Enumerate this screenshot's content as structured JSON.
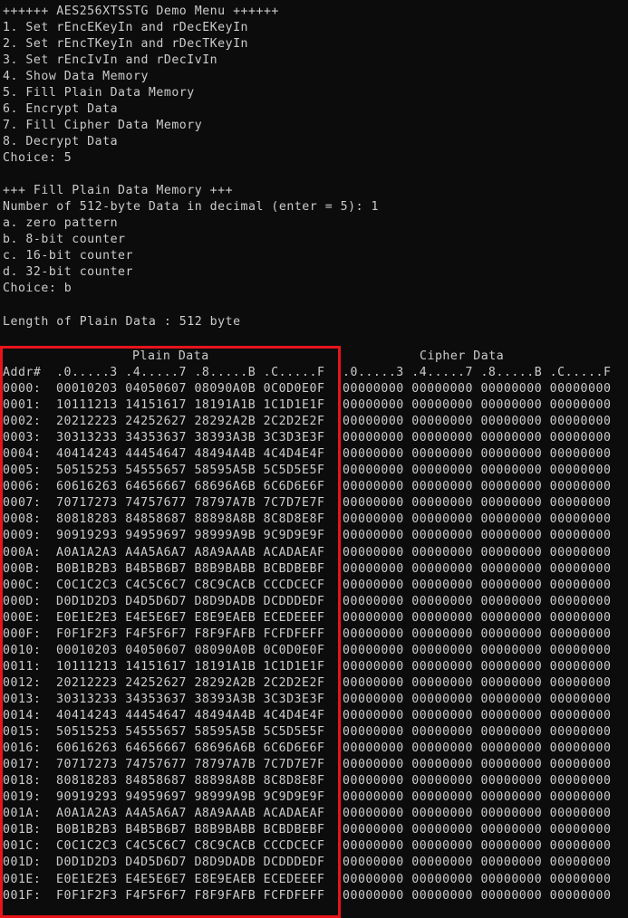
{
  "menu": {
    "title": "++++++ AES256XTSSTG Demo Menu ++++++",
    "items": [
      "1. Set rEncEKeyIn and rDecEKeyIn",
      "2. Set rEncTKeyIn and rDecTKeyIn",
      "3. Set rEncIvIn and rDecIvIn",
      "4. Show Data Memory",
      "5. Fill Plain Data Memory",
      "6. Encrypt Data",
      "7. Fill Cipher Data Memory",
      "8. Decrypt Data"
    ],
    "choice": "Choice: 5"
  },
  "fill": {
    "title": "+++ Fill Plain Data Memory +++",
    "prompt": "Number of 512-byte Data in decimal (enter = 5): 1",
    "options": [
      "a. zero pattern",
      "b. 8-bit counter",
      "c. 16-bit counter",
      "d. 32-bit counter"
    ],
    "choice": "Choice: b"
  },
  "length_line": "Length of Plain Data : 512 byte",
  "table": {
    "plain_title": "Plain Data",
    "cipher_title": "Cipher Data",
    "addr_header": "Addr#",
    "plain_cols_header": ".0.....3 .4.....7 .8.....B .C.....F",
    "cipher_cols_header": ".0.....3 .4.....7 .8.....B .C.....F",
    "rows": [
      {
        "addr": "0000:",
        "plain": "00010203 04050607 08090A0B 0C0D0E0F",
        "cipher": "00000000 00000000 00000000 00000000"
      },
      {
        "addr": "0001:",
        "plain": "10111213 14151617 18191A1B 1C1D1E1F",
        "cipher": "00000000 00000000 00000000 00000000"
      },
      {
        "addr": "0002:",
        "plain": "20212223 24252627 28292A2B 2C2D2E2F",
        "cipher": "00000000 00000000 00000000 00000000"
      },
      {
        "addr": "0003:",
        "plain": "30313233 34353637 38393A3B 3C3D3E3F",
        "cipher": "00000000 00000000 00000000 00000000"
      },
      {
        "addr": "0004:",
        "plain": "40414243 44454647 48494A4B 4C4D4E4F",
        "cipher": "00000000 00000000 00000000 00000000"
      },
      {
        "addr": "0005:",
        "plain": "50515253 54555657 58595A5B 5C5D5E5F",
        "cipher": "00000000 00000000 00000000 00000000"
      },
      {
        "addr": "0006:",
        "plain": "60616263 64656667 68696A6B 6C6D6E6F",
        "cipher": "00000000 00000000 00000000 00000000"
      },
      {
        "addr": "0007:",
        "plain": "70717273 74757677 78797A7B 7C7D7E7F",
        "cipher": "00000000 00000000 00000000 00000000"
      },
      {
        "addr": "0008:",
        "plain": "80818283 84858687 88898A8B 8C8D8E8F",
        "cipher": "00000000 00000000 00000000 00000000"
      },
      {
        "addr": "0009:",
        "plain": "90919293 94959697 98999A9B 9C9D9E9F",
        "cipher": "00000000 00000000 00000000 00000000"
      },
      {
        "addr": "000A:",
        "plain": "A0A1A2A3 A4A5A6A7 A8A9AAAB ACADAEAF",
        "cipher": "00000000 00000000 00000000 00000000"
      },
      {
        "addr": "000B:",
        "plain": "B0B1B2B3 B4B5B6B7 B8B9BABB BCBDBEBF",
        "cipher": "00000000 00000000 00000000 00000000"
      },
      {
        "addr": "000C:",
        "plain": "C0C1C2C3 C4C5C6C7 C8C9CACB CCCDCECF",
        "cipher": "00000000 00000000 00000000 00000000"
      },
      {
        "addr": "000D:",
        "plain": "D0D1D2D3 D4D5D6D7 D8D9DADB DCDDDEDF",
        "cipher": "00000000 00000000 00000000 00000000"
      },
      {
        "addr": "000E:",
        "plain": "E0E1E2E3 E4E5E6E7 E8E9EAEB ECEDEEEF",
        "cipher": "00000000 00000000 00000000 00000000"
      },
      {
        "addr": "000F:",
        "plain": "F0F1F2F3 F4F5F6F7 F8F9FAFB FCFDFEFF",
        "cipher": "00000000 00000000 00000000 00000000"
      },
      {
        "addr": "0010:",
        "plain": "00010203 04050607 08090A0B 0C0D0E0F",
        "cipher": "00000000 00000000 00000000 00000000"
      },
      {
        "addr": "0011:",
        "plain": "10111213 14151617 18191A1B 1C1D1E1F",
        "cipher": "00000000 00000000 00000000 00000000"
      },
      {
        "addr": "0012:",
        "plain": "20212223 24252627 28292A2B 2C2D2E2F",
        "cipher": "00000000 00000000 00000000 00000000"
      },
      {
        "addr": "0013:",
        "plain": "30313233 34353637 38393A3B 3C3D3E3F",
        "cipher": "00000000 00000000 00000000 00000000"
      },
      {
        "addr": "0014:",
        "plain": "40414243 44454647 48494A4B 4C4D4E4F",
        "cipher": "00000000 00000000 00000000 00000000"
      },
      {
        "addr": "0015:",
        "plain": "50515253 54555657 58595A5B 5C5D5E5F",
        "cipher": "00000000 00000000 00000000 00000000"
      },
      {
        "addr": "0016:",
        "plain": "60616263 64656667 68696A6B 6C6D6E6F",
        "cipher": "00000000 00000000 00000000 00000000"
      },
      {
        "addr": "0017:",
        "plain": "70717273 74757677 78797A7B 7C7D7E7F",
        "cipher": "00000000 00000000 00000000 00000000"
      },
      {
        "addr": "0018:",
        "plain": "80818283 84858687 88898A8B 8C8D8E8F",
        "cipher": "00000000 00000000 00000000 00000000"
      },
      {
        "addr": "0019:",
        "plain": "90919293 94959697 98999A9B 9C9D9E9F",
        "cipher": "00000000 00000000 00000000 00000000"
      },
      {
        "addr": "001A:",
        "plain": "A0A1A2A3 A4A5A6A7 A8A9AAAB ACADAEAF",
        "cipher": "00000000 00000000 00000000 00000000"
      },
      {
        "addr": "001B:",
        "plain": "B0B1B2B3 B4B5B6B7 B8B9BABB BCBDBEBF",
        "cipher": "00000000 00000000 00000000 00000000"
      },
      {
        "addr": "001C:",
        "plain": "C0C1C2C3 C4C5C6C7 C8C9CACB CCCDCECF",
        "cipher": "00000000 00000000 00000000 00000000"
      },
      {
        "addr": "001D:",
        "plain": "D0D1D2D3 D4D5D6D7 D8D9DADB DCDDDEDF",
        "cipher": "00000000 00000000 00000000 00000000"
      },
      {
        "addr": "001E:",
        "plain": "E0E1E2E3 E4E5E6E7 E8E9EAEB ECEDEEEF",
        "cipher": "00000000 00000000 00000000 00000000"
      },
      {
        "addr": "001F:",
        "plain": "F0F1F2F3 F4F5F6F7 F8F9FAFB FCFDFEFF",
        "cipher": "00000000 00000000 00000000 00000000"
      }
    ]
  },
  "colors": {
    "background": "#0c0c0c",
    "text": "#cccccc",
    "highlight_border": "#e8141b"
  }
}
